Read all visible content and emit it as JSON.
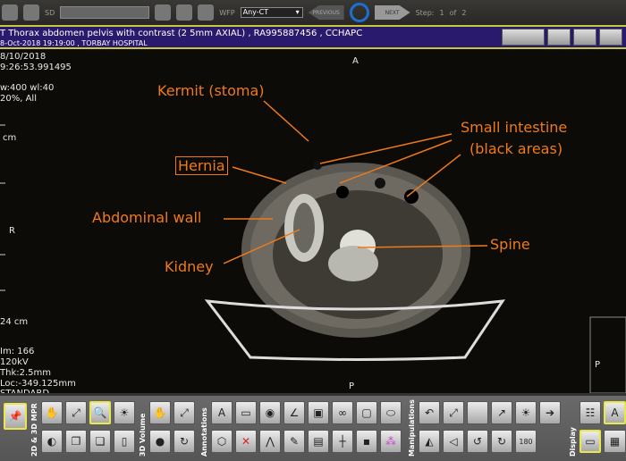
{
  "topbar": {
    "sd_label": "SD",
    "wfp_label": "WFP",
    "wfp_value": "Any-CT",
    "previous_label": "PREVIOUS",
    "next_label": "NEXT",
    "step_label": "Step:",
    "step_current": "1",
    "step_of": "of",
    "step_total": "2"
  },
  "titlebar": {
    "line1": "T Thorax abdomen pelvis with contrast  (2 5mm AXIAL) , RA995887456 , CCHAPC",
    "line2": "8-Oct-2018 19:19:00 , TORBAY HOSPITAL"
  },
  "overlay": {
    "date": "8/10/2018",
    "time": "9:26:53.991495",
    "window": "w:400 wl:40",
    "zoom": "20%, All",
    "scale_unit": "cm",
    "orient_top": "A",
    "orient_left": "R",
    "orient_bottom": "P",
    "orient_right": "P",
    "scale_len": "24 cm",
    "image": "Im: 166",
    "kv": "120kV",
    "thickness": "Thk:2.5mm",
    "location": "Loc:-349.125mm",
    "kernel": "STANDARD"
  },
  "annotations": {
    "kermit": "Kermit (stoma)",
    "hernia": "Hernia",
    "small_intestine_1": "Small intestine",
    "small_intestine_2": "(black areas)",
    "abdominal_wall": "Abdominal wall",
    "spine": "Spine",
    "kidney": "Kidney"
  },
  "toolbar": {
    "group_2d3d": "2D & 3D MPR",
    "group_3dvol": "3D Volume",
    "group_annotations": "Annotations",
    "group_manipulations": "Manipulations",
    "group_display": "Display",
    "text_tool": "A",
    "rotate_180": "180"
  },
  "colors": {
    "annotation": "#f07a1a",
    "titlebar": "#2a1a6e",
    "highlight": "#e8e84a"
  }
}
